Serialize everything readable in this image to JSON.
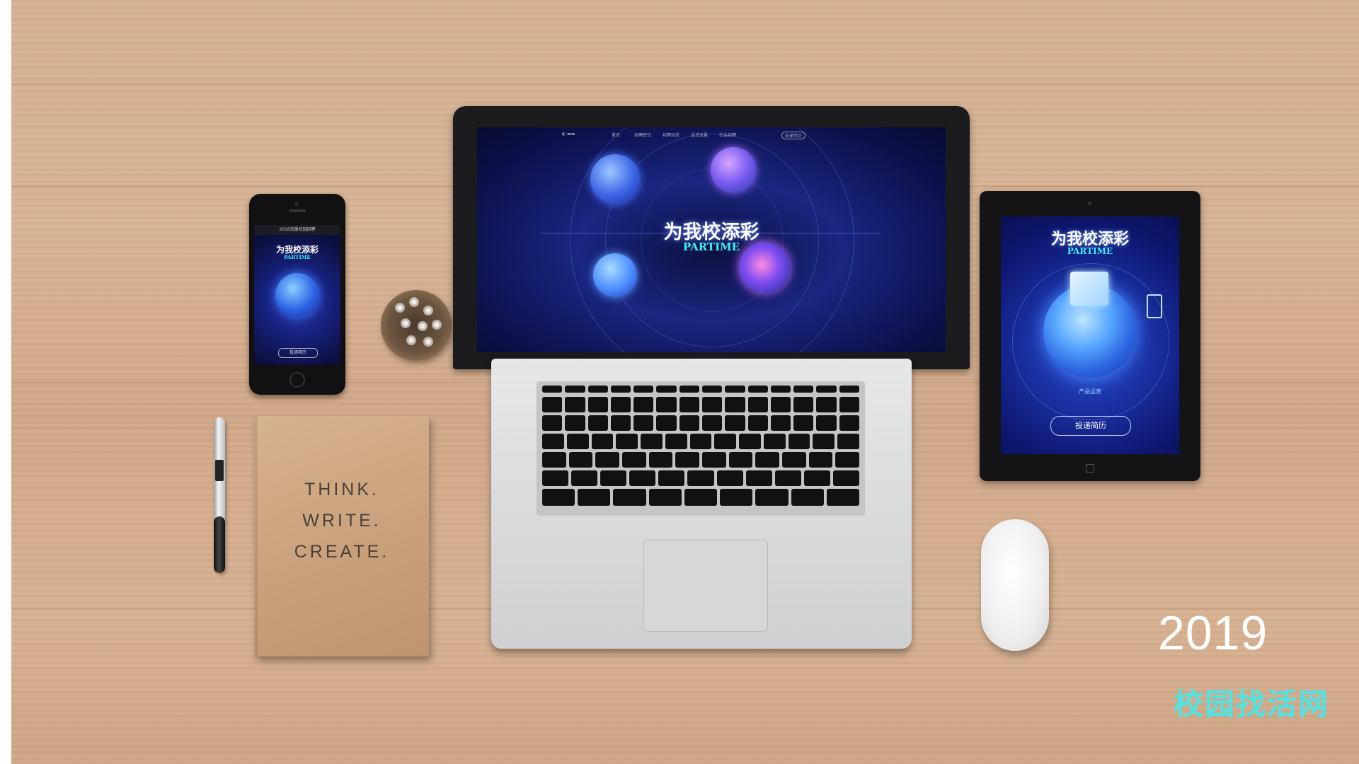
{
  "phone": {
    "nav_text": "2018流量校园招聘",
    "title": "为我校添彩",
    "subtitle": "PARTIME",
    "button": "投递简历"
  },
  "notebook": {
    "lines": [
      "THINK.",
      "WRITE.",
      "CREATE."
    ]
  },
  "laptop": {
    "nav": [
      "首页",
      "招聘职位",
      "招聘动态",
      "走进流量",
      "社会招聘"
    ],
    "login_button": "投递简历",
    "title": "为我校添彩",
    "subtitle": "PARTIME"
  },
  "tablet": {
    "title": "为我校添彩",
    "subtitle": "PARTIME",
    "label": "产品运营",
    "button": "投递简历"
  },
  "caption": {
    "year": "2019",
    "brand": "校园找活网"
  },
  "colors": {
    "accent_cyan": "#3af1ff",
    "brand_teal": "#4fe3e4",
    "screen_blue": "#1a2680"
  }
}
